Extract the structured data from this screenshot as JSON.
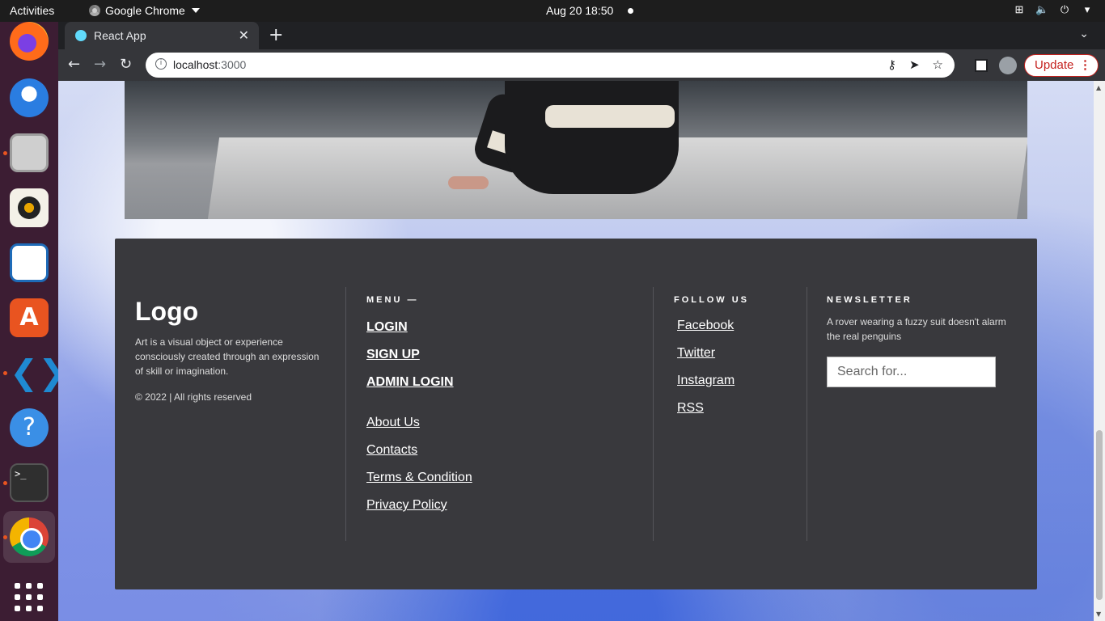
{
  "system": {
    "activities": "Activities",
    "app_name": "Google Chrome",
    "clock": "Aug 20  18:50"
  },
  "browser": {
    "tab_title": "React App",
    "url_host": "localhost",
    "url_port": ":3000",
    "update_label": "Update"
  },
  "footer": {
    "logo": "Logo",
    "description": "Art is a visual object or experience consciously created through an expression of skill or imagination.",
    "copyright": "© 2022 | All rights reserved",
    "menu_heading": "MENU —",
    "menu_primary": [
      "LOGIN",
      "SIGN UP",
      "ADMIN LOGIN"
    ],
    "menu_secondary": [
      "About Us",
      "Contacts",
      "Terms & Condition",
      "Privacy Policy"
    ],
    "follow_heading": "FOLLOW US",
    "social": [
      "Facebook",
      "Twitter",
      "Instagram",
      "RSS"
    ],
    "newsletter_heading": "NEWSLETTER",
    "newsletter_text": "A rover wearing a fuzzy suit doesn't alarm the real penguins",
    "search_placeholder": "Search for..."
  },
  "colors": {
    "footer_bg": "#39393d",
    "dock_bg": "#3c1d33",
    "update_red": "#c5221f"
  },
  "icons": [
    "firefox-icon",
    "thunderbird-icon",
    "files-icon",
    "rhythmbox-icon",
    "writer-icon",
    "app-store-icon",
    "vscode-icon",
    "help-icon",
    "terminal-icon",
    "chrome-icon",
    "show-apps-icon"
  ]
}
